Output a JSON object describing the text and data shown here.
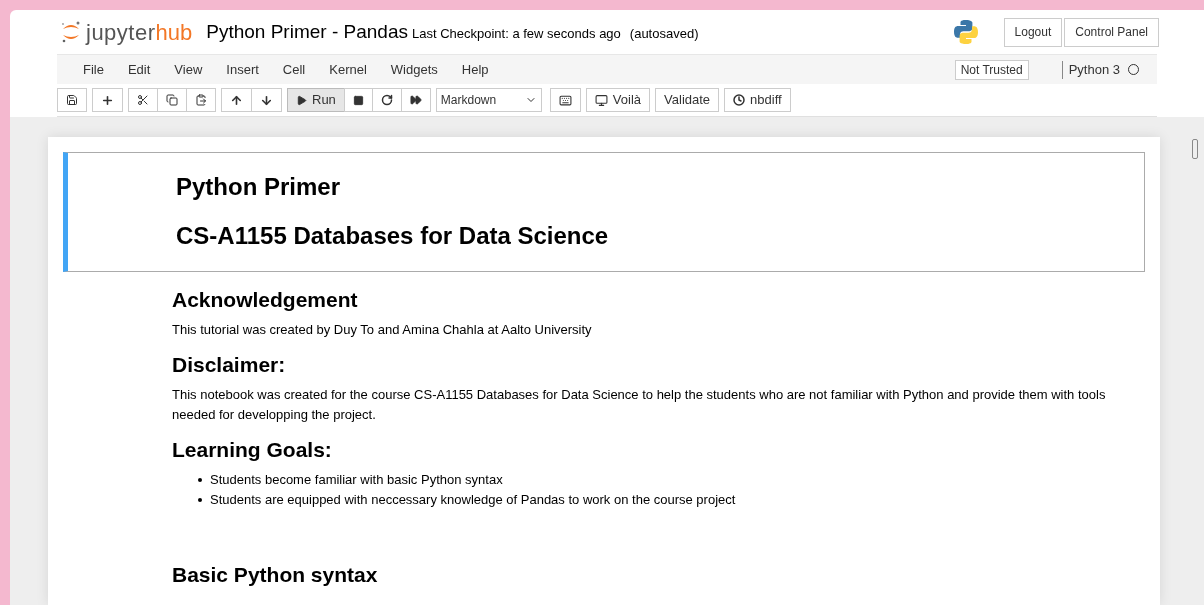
{
  "header": {
    "logo_left": "jupyter",
    "logo_right": "hub",
    "notebook_title": "Python Primer - Pandas",
    "checkpoint": "Last Checkpoint: a few seconds ago",
    "autosave": "(autosaved)",
    "buttons": [
      "Logout",
      "Control Panel"
    ]
  },
  "menu": {
    "items": [
      "File",
      "Edit",
      "View",
      "Insert",
      "Cell",
      "Kernel",
      "Widgets",
      "Help"
    ],
    "trust": "Not Trusted",
    "kernel": "Python 3",
    "kernel_busy": false
  },
  "toolbar": {
    "run_label": "Run",
    "cell_type": "Markdown",
    "extra_buttons": [
      "Voilà",
      "Validate",
      "nbdiff"
    ]
  },
  "cells": [
    {
      "selected": true,
      "blocks": [
        {
          "kind": "h1",
          "text": "Python Primer"
        },
        {
          "kind": "h1",
          "text": "CS-A1155 Databases for Data Science"
        }
      ]
    },
    {
      "selected": false,
      "blocks": [
        {
          "kind": "h2",
          "text": "Acknowledgement"
        },
        {
          "kind": "p",
          "text": "This tutorial was created by Duy To and Amina Chahla at Aalto University"
        },
        {
          "kind": "h2",
          "text": "Disclaimer:"
        },
        {
          "kind": "p",
          "text": "This notebook was created for the course CS-A1155 Databases for Data Science to help the students who are not familiar with Python and provide them with tools needed for developping the project."
        },
        {
          "kind": "h2",
          "text": "Learning Goals:"
        },
        {
          "kind": "ul",
          "items": [
            "Students become familiar with basic Python syntax",
            "Students are equipped with neccessary knowledge of Pandas to work on the course project"
          ]
        }
      ]
    },
    {
      "selected": false,
      "blocks": [
        {
          "kind": "h2",
          "text": "Basic Python syntax"
        }
      ]
    }
  ]
}
